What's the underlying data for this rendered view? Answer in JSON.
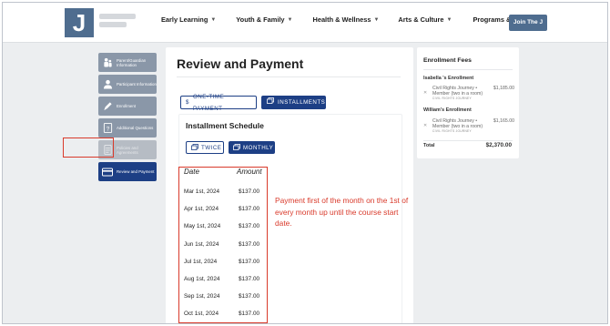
{
  "header": {
    "logo_letter": "J",
    "nav": [
      {
        "label": "Early Learning"
      },
      {
        "label": "Youth & Family"
      },
      {
        "label": "Health & Wellness"
      },
      {
        "label": "Arts & Culture"
      },
      {
        "label": "Programs & Classes"
      }
    ],
    "join_label": "Join The J"
  },
  "steps": [
    {
      "label": "Parent/Guardian Information",
      "icon": "family-icon",
      "state": "done"
    },
    {
      "label": "Participant Information",
      "icon": "person-icon",
      "state": "done"
    },
    {
      "label": "Enrollment",
      "icon": "pencil-icon",
      "state": "done"
    },
    {
      "label": "Additional Questions",
      "icon": "question-icon",
      "state": "done"
    },
    {
      "label": "Policies and Agreements",
      "icon": "document-icon",
      "state": "disabled"
    },
    {
      "label": "Review and Payment",
      "icon": "credit-card-icon",
      "state": "active"
    }
  ],
  "main": {
    "title": "Review and Payment",
    "tabs": {
      "one_time": "ONE-TIME PAYMENT",
      "installments": "INSTALLMENTS"
    },
    "schedule_title": "Installment Schedule",
    "frequency": {
      "twice": "TWICE",
      "monthly": "MONTHLY"
    },
    "table": {
      "headers": {
        "date": "Date",
        "amount": "Amount"
      },
      "rows": [
        {
          "date": "Mar 1st, 2024",
          "amount": "$137.00"
        },
        {
          "date": "Apr 1st, 2024",
          "amount": "$137.00"
        },
        {
          "date": "May 1st, 2024",
          "amount": "$137.00"
        },
        {
          "date": "Jun 1st, 2024",
          "amount": "$137.00"
        },
        {
          "date": "Jul 1st, 2024",
          "amount": "$137.00"
        },
        {
          "date": "Aug 1st, 2024",
          "amount": "$137.00"
        },
        {
          "date": "Sep 1st, 2024",
          "amount": "$137.00"
        },
        {
          "date": "Oct 1st, 2024",
          "amount": "$137.00"
        }
      ]
    },
    "annotation": "Payment first of the month on the 1st of every month up until the course start date."
  },
  "fees": {
    "title": "Enrollment Fees",
    "enrollments": [
      {
        "person": "Isabella 's Enrollment",
        "course": "Civil Rights Journey •",
        "amount": "$1,185.00",
        "member": "Member (two in a room)",
        "tag": "CIVIL RIGHTS JOURNEY"
      },
      {
        "person": "William's Enrollment",
        "course": "Civil Rights Journey •",
        "amount": "$1,165.00",
        "member": "Member (two in a room)",
        "tag": "CIVIL RIGHTS JOURNEY"
      }
    ],
    "total_label": "Total",
    "total_value": "$2,370.00"
  },
  "colors": {
    "brand": "#4f6d8f",
    "primary": "#1d3f85",
    "annotation": "#d93a2b",
    "background": "#eceef0"
  }
}
